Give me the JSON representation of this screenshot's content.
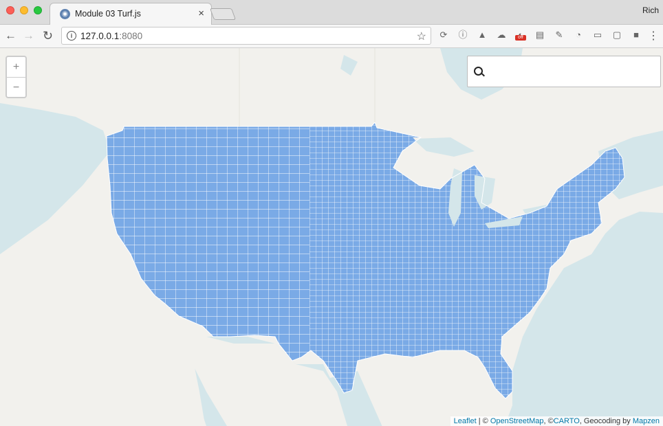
{
  "browser": {
    "tab": {
      "title": "Module 03 Turf.js",
      "close": "×"
    },
    "profile": "Rich",
    "nav": {
      "back": "←",
      "forward": "→",
      "reload": "↻"
    },
    "url": {
      "host": "127.0.0.1",
      "port": ":8080"
    },
    "star": "☆",
    "extensions": [
      {
        "name": "sync-icon",
        "glyph": "⟳"
      },
      {
        "name": "info-circle-icon",
        "glyph": "ⓘ"
      },
      {
        "name": "drive-icon",
        "glyph": "▲"
      },
      {
        "name": "cloud-icon",
        "glyph": "☁"
      },
      {
        "name": "extension-off-icon",
        "glyph": "◐",
        "badge": "off"
      },
      {
        "name": "document-icon",
        "glyph": "▤"
      },
      {
        "name": "pen-icon",
        "glyph": "✎"
      },
      {
        "name": "disc-icon",
        "glyph": "◔"
      },
      {
        "name": "cast-icon",
        "glyph": "▭"
      },
      {
        "name": "chat-icon",
        "glyph": "▢"
      },
      {
        "name": "stop-icon",
        "glyph": "■"
      }
    ],
    "menu": "⋮"
  },
  "map": {
    "zoom_in": "+",
    "zoom_out": "−",
    "search": {
      "value": "",
      "placeholder": ""
    },
    "attribution": {
      "leaflet": "Leaflet",
      "sep1": " | © ",
      "osm": "OpenStreetMap",
      "sep2": ", ©",
      "carto": "CARTO",
      "sep3": ", Geocoding by ",
      "mapzen": "Mapzen"
    },
    "colors": {
      "water": "#d4e6ea",
      "land": "#f2f1ed",
      "counties": "#7aaae6",
      "county_lines": "#ffffff"
    }
  }
}
